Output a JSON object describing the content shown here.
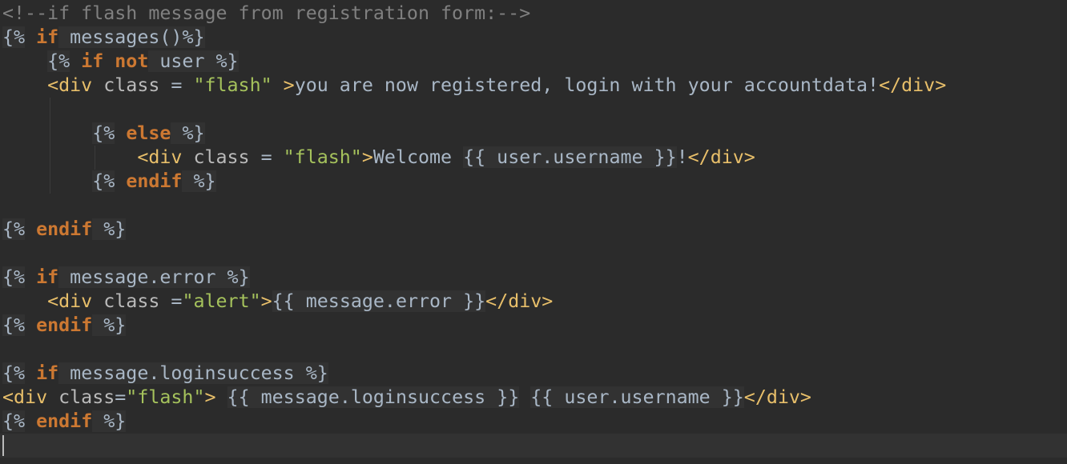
{
  "editor": {
    "lines": [
      {
        "indent": "",
        "tokens": [
          {
            "t": "comment",
            "v": "<!--if flash message from registration form:-->"
          }
        ]
      },
      {
        "indent": "",
        "tokens": [
          {
            "t": "delim",
            "v": "{%"
          },
          {
            "t": "text",
            "v": " "
          },
          {
            "t": "kw",
            "v": "if"
          },
          {
            "t": "var",
            "v": " messages()"
          },
          {
            "t": "delim",
            "v": "%}"
          }
        ]
      },
      {
        "indent": "    ",
        "tokens": [
          {
            "t": "delim",
            "v": "{%"
          },
          {
            "t": "text",
            "v": " "
          },
          {
            "t": "kw",
            "v": "if not"
          },
          {
            "t": "var",
            "v": " user "
          },
          {
            "t": "delim",
            "v": "%}"
          }
        ]
      },
      {
        "indent": "    ",
        "tokens": [
          {
            "t": "tag",
            "v": "<div"
          },
          {
            "t": "attr",
            "v": " class"
          },
          {
            "t": "op",
            "v": " = "
          },
          {
            "t": "str",
            "v": "\"flash\""
          },
          {
            "t": "tag",
            "v": " >"
          },
          {
            "t": "text",
            "v": "you are now registered, login with your "
          },
          {
            "t": "typo",
            "v": "accountdata"
          },
          {
            "t": "text",
            "v": "!"
          },
          {
            "t": "tag",
            "v": "</div>"
          }
        ]
      },
      {
        "indent": "",
        "tokens": []
      },
      {
        "indent": "        ",
        "tokens": [
          {
            "t": "delim",
            "v": "{%"
          },
          {
            "t": "text",
            "v": " "
          },
          {
            "t": "kw",
            "v": "else"
          },
          {
            "t": "var",
            "v": " "
          },
          {
            "t": "delim",
            "v": "%}"
          }
        ]
      },
      {
        "indent": "            ",
        "tokens": [
          {
            "t": "tag",
            "v": "<div"
          },
          {
            "t": "attr",
            "v": " class"
          },
          {
            "t": "op",
            "v": " = "
          },
          {
            "t": "str",
            "v": "\"flash\""
          },
          {
            "t": "tag",
            "v": ">"
          },
          {
            "t": "text",
            "v": "Welcome "
          },
          {
            "t": "delim",
            "v": "{{"
          },
          {
            "t": "var",
            "v": " user.username "
          },
          {
            "t": "delim",
            "v": "}}"
          },
          {
            "t": "text",
            "v": "!"
          },
          {
            "t": "tag",
            "v": "</div>"
          }
        ]
      },
      {
        "indent": "        ",
        "tokens": [
          {
            "t": "delim",
            "v": "{%"
          },
          {
            "t": "text",
            "v": " "
          },
          {
            "t": "kw",
            "v": "endif"
          },
          {
            "t": "var",
            "v": " "
          },
          {
            "t": "delim",
            "v": "%}"
          }
        ]
      },
      {
        "indent": "",
        "tokens": []
      },
      {
        "indent": "",
        "tokens": [
          {
            "t": "delim",
            "v": "{%"
          },
          {
            "t": "text",
            "v": " "
          },
          {
            "t": "kw",
            "v": "endif"
          },
          {
            "t": "var",
            "v": " "
          },
          {
            "t": "delim",
            "v": "%}"
          }
        ]
      },
      {
        "indent": "",
        "tokens": []
      },
      {
        "indent": "",
        "tokens": [
          {
            "t": "delim",
            "v": "{%"
          },
          {
            "t": "text",
            "v": " "
          },
          {
            "t": "kw",
            "v": "if"
          },
          {
            "t": "var",
            "v": " message.error "
          },
          {
            "t": "delim",
            "v": "%}"
          }
        ]
      },
      {
        "indent": "    ",
        "tokens": [
          {
            "t": "tag",
            "v": "<div"
          },
          {
            "t": "attr",
            "v": " class"
          },
          {
            "t": "op",
            "v": " ="
          },
          {
            "t": "str",
            "v": "\"alert\""
          },
          {
            "t": "tag",
            "v": ">"
          },
          {
            "t": "delim",
            "v": "{{"
          },
          {
            "t": "var",
            "v": " message.error "
          },
          {
            "t": "delim",
            "v": "}}"
          },
          {
            "t": "tag",
            "v": "</div>"
          }
        ]
      },
      {
        "indent": "",
        "tokens": [
          {
            "t": "delim",
            "v": "{%"
          },
          {
            "t": "text",
            "v": " "
          },
          {
            "t": "kw",
            "v": "endif"
          },
          {
            "t": "var",
            "v": " "
          },
          {
            "t": "delim",
            "v": "%}"
          }
        ]
      },
      {
        "indent": "",
        "tokens": []
      },
      {
        "indent": "",
        "tokens": [
          {
            "t": "delim",
            "v": "{%"
          },
          {
            "t": "text",
            "v": " "
          },
          {
            "t": "kw",
            "v": "if"
          },
          {
            "t": "var",
            "v": " message.loginsuccess "
          },
          {
            "t": "delim",
            "v": "%}"
          }
        ]
      },
      {
        "indent": "",
        "tokens": [
          {
            "t": "tag",
            "v": "<div"
          },
          {
            "t": "attr",
            "v": " class"
          },
          {
            "t": "op",
            "v": "="
          },
          {
            "t": "str",
            "v": "\"flash\""
          },
          {
            "t": "tag",
            "v": ">"
          },
          {
            "t": "text",
            "v": " "
          },
          {
            "t": "delim",
            "v": "{{"
          },
          {
            "t": "var",
            "v": " message.loginsuccess "
          },
          {
            "t": "delim",
            "v": "}}"
          },
          {
            "t": "text",
            "v": " "
          },
          {
            "t": "delim",
            "v": "{{"
          },
          {
            "t": "var",
            "v": " user.username "
          },
          {
            "t": "delim",
            "v": "}}"
          },
          {
            "t": "tag",
            "v": "</div>"
          }
        ]
      },
      {
        "indent": "",
        "tokens": [
          {
            "t": "delim",
            "v": "{%"
          },
          {
            "t": "text",
            "v": " "
          },
          {
            "t": "kw",
            "v": "endif"
          },
          {
            "t": "var",
            "v": " "
          },
          {
            "t": "delim",
            "v": "%}"
          }
        ]
      },
      {
        "indent": "",
        "tokens": []
      }
    ]
  },
  "colors": {
    "background": "#2b2b2b",
    "current_line": "#323232",
    "comment": "#808080",
    "keyword": "#cc7832",
    "tag": "#e8bf6a",
    "string": "#a5c25c",
    "text": "#a9b7c6"
  }
}
